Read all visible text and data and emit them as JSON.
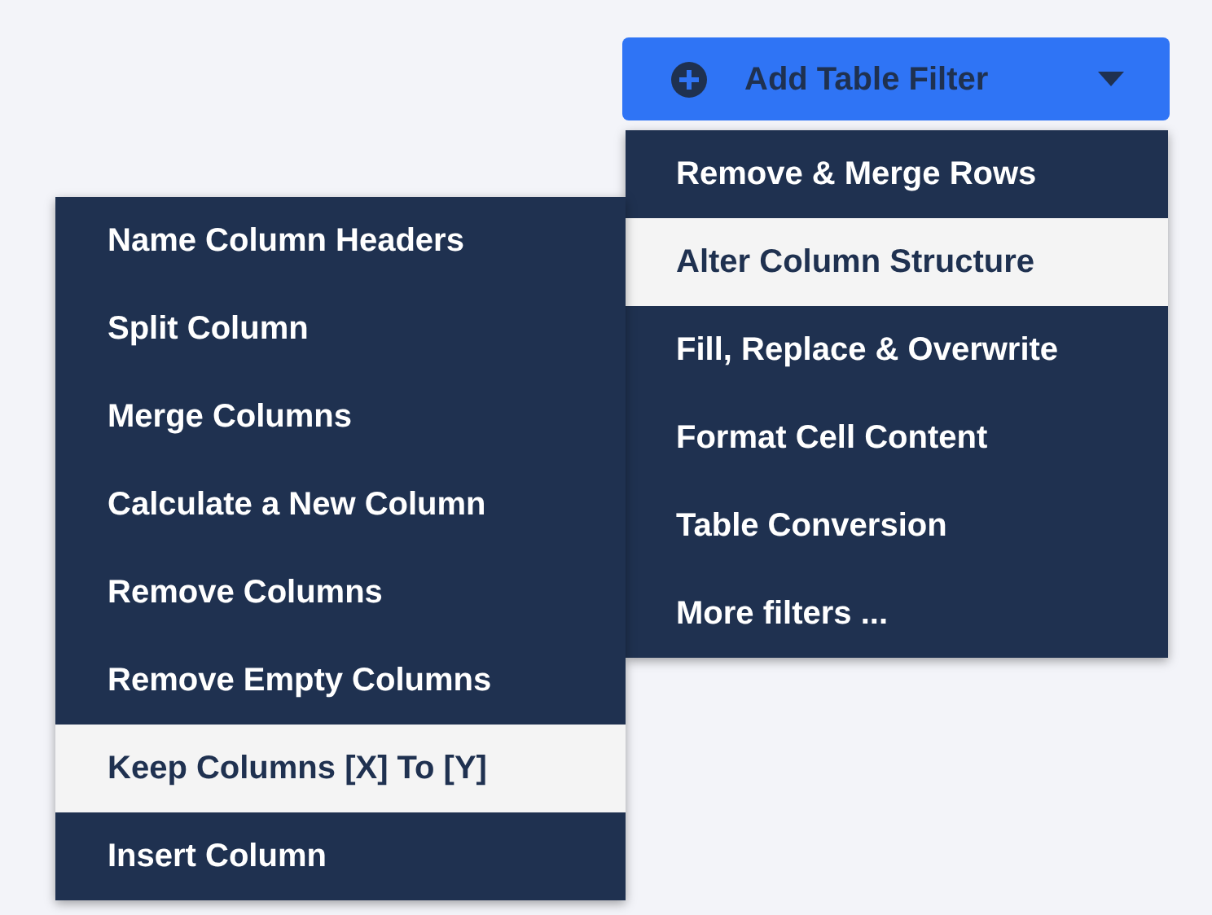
{
  "filter_button": {
    "label": "Add Table Filter"
  },
  "menu": {
    "items": [
      {
        "label": "Remove & Merge Rows",
        "selected": false
      },
      {
        "label": "Alter Column Structure",
        "selected": true
      },
      {
        "label": "Fill, Replace & Overwrite",
        "selected": false
      },
      {
        "label": "Format Cell Content",
        "selected": false
      },
      {
        "label": "Table Conversion",
        "selected": false
      },
      {
        "label": "More filters ...",
        "selected": false
      }
    ]
  },
  "submenu": {
    "items": [
      {
        "label": "Name Column Headers",
        "selected": false
      },
      {
        "label": "Split Column",
        "selected": false
      },
      {
        "label": "Merge Columns",
        "selected": false
      },
      {
        "label": "Calculate a New Column",
        "selected": false
      },
      {
        "label": "Remove Columns",
        "selected": false
      },
      {
        "label": "Remove Empty Columns",
        "selected": false
      },
      {
        "label": "Keep Columns [X] To [Y]",
        "selected": true
      },
      {
        "label": "Insert Column",
        "selected": false
      }
    ]
  }
}
